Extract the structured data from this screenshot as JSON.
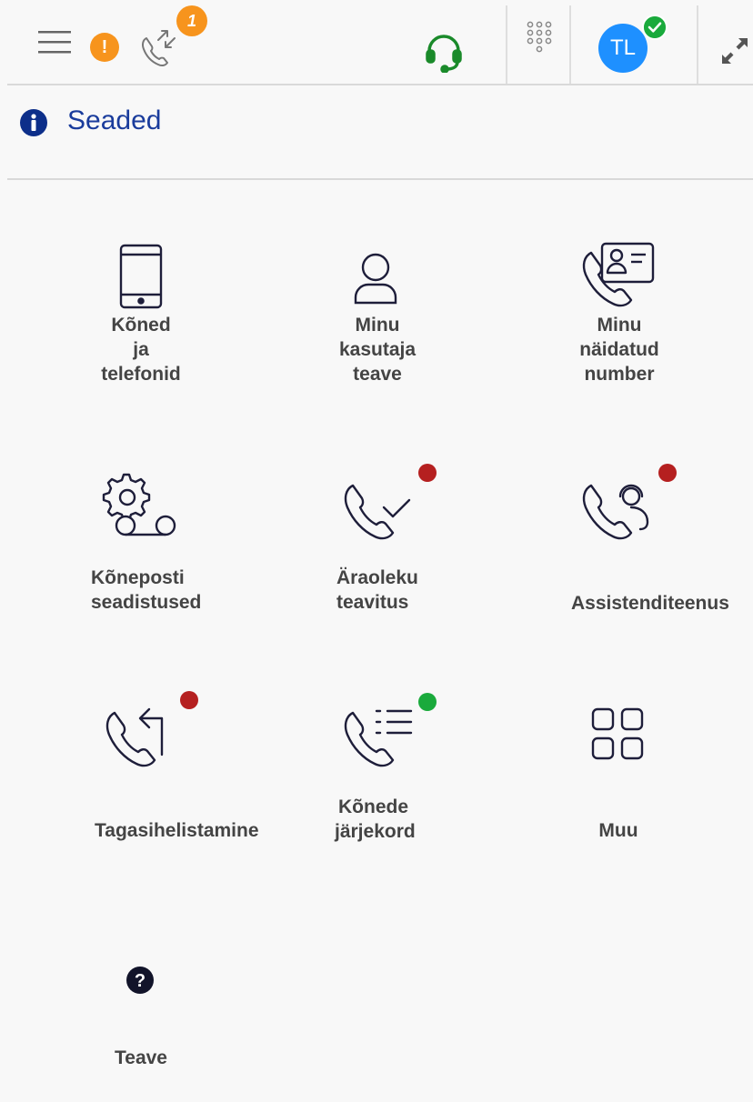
{
  "topbar": {
    "alert_glyph": "!",
    "transfer_badge": "1",
    "avatar_initials": "TL",
    "colors": {
      "alert": "#f7941d",
      "avatar": "#1e90ff",
      "presence": "#1aaa3c",
      "headset": "#1a8a2a"
    },
    "icons": [
      "menu-icon",
      "alert-icon",
      "call-transfer-icon",
      "headset-icon",
      "dialpad-icon",
      "avatar",
      "expand-icon"
    ]
  },
  "header": {
    "title": "Seaded",
    "icon": "info-icon"
  },
  "tiles": [
    {
      "label_lines": [
        "Kõned",
        "ja",
        "telefonid"
      ],
      "icon": "mobile-phone-icon",
      "status": null
    },
    {
      "label_lines": [
        "Minu",
        "kasutaja",
        "teave"
      ],
      "icon": "user-icon",
      "status": null
    },
    {
      "label_lines": [
        "Minu",
        "näidatud",
        "number"
      ],
      "icon": "phone-id-card-icon",
      "status": null
    },
    {
      "label_lines": [
        "Kõneposti",
        "seadistused"
      ],
      "icon": "voicemail-settings-icon",
      "status": null
    },
    {
      "label_lines": [
        "Äraoleku",
        "teavitus"
      ],
      "icon": "phone-check-icon",
      "status": "red"
    },
    {
      "label_lines": [
        "Assistenditeenus"
      ],
      "icon": "phone-assistant-icon",
      "status": "red"
    },
    {
      "label_lines": [
        "Tagasihelistamine"
      ],
      "icon": "callback-icon",
      "status": "red"
    },
    {
      "label_lines": [
        "Kõnede",
        "järjekord"
      ],
      "icon": "call-queue-icon",
      "status": "green"
    },
    {
      "label_lines": [
        "Muu"
      ],
      "icon": "grid-icon",
      "status": null
    },
    {
      "label_lines": [
        "Teave"
      ],
      "icon": "help-icon",
      "status": null
    }
  ],
  "status_colors": {
    "red": "#b52020",
    "green": "#1aaa3c"
  }
}
